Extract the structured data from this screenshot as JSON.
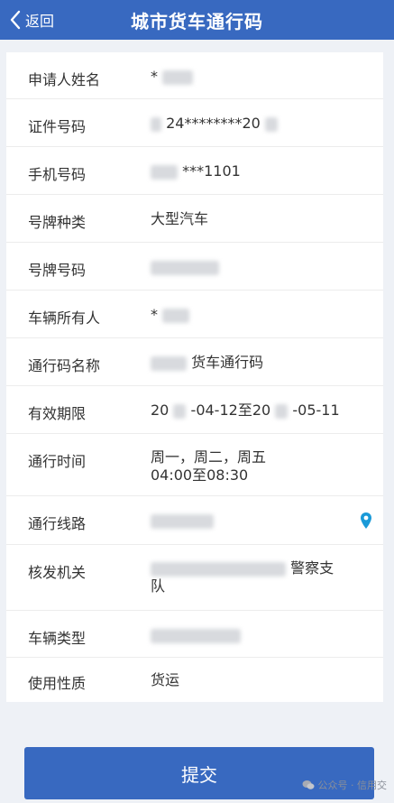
{
  "header": {
    "back_label": "返回",
    "title": "城市货车通行码"
  },
  "form": {
    "rows": [
      {
        "label": "申请人姓名",
        "value": "*"
      },
      {
        "label": "证件号码",
        "value": "24********20"
      },
      {
        "label": "手机号码",
        "value": "***1101"
      },
      {
        "label": "号牌种类",
        "value": "大型汽车"
      },
      {
        "label": "号牌号码",
        "value": ""
      },
      {
        "label": "车辆所有人",
        "value": "*"
      },
      {
        "label": "通行码名称",
        "value": "货车通行码"
      },
      {
        "label": "有效期限",
        "value_parts": [
          "20",
          "-04-12至20",
          "-05-11"
        ]
      },
      {
        "label": "通行时间",
        "value_lines": [
          "周一，周二，周五",
          "04:00至08:30"
        ]
      },
      {
        "label": "通行线路",
        "value": ""
      },
      {
        "label": "核发机关",
        "value": "警察支",
        "value_line2": "队"
      },
      {
        "label": "车辆类型",
        "value": ""
      },
      {
        "label": "使用性质",
        "value": "货运"
      }
    ]
  },
  "submit_label": "提交",
  "watermark": "公众号 · 信用交",
  "icons": {
    "back": "chevron-left-icon",
    "location": "location-pin-icon",
    "watermark": "wechat-icon"
  },
  "colors": {
    "primary": "#3869c0",
    "location_icon": "#1a9ad8"
  }
}
